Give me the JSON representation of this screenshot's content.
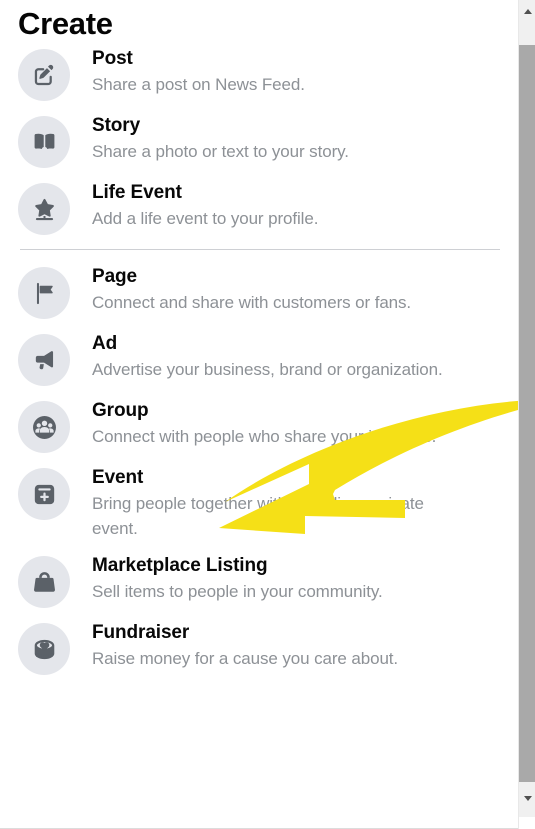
{
  "panel": {
    "title": "Create",
    "groups": [
      {
        "id": "personal",
        "items": [
          {
            "icon": "edit-square-icon",
            "title": "Post",
            "desc": "Share a post on News Feed."
          },
          {
            "icon": "open-book-icon",
            "title": "Story",
            "desc": "Share a photo or text to your story."
          },
          {
            "icon": "star-badge-icon",
            "title": "Life Event",
            "desc": "Add a life event to your profile."
          }
        ]
      },
      {
        "id": "business",
        "items": [
          {
            "icon": "flag-icon",
            "title": "Page",
            "desc": "Connect and share with customers or fans."
          },
          {
            "icon": "megaphone-icon",
            "title": "Ad",
            "desc": "Advertise your business, brand or organization."
          },
          {
            "icon": "people-group-icon",
            "title": "Group",
            "desc": "Connect with people who share your interests."
          },
          {
            "icon": "calendar-plus-icon",
            "title": "Event",
            "desc": "Bring people together with a public or private event."
          },
          {
            "icon": "shopping-bag-icon",
            "title": "Marketplace Listing",
            "desc": "Sell items to people in your community."
          },
          {
            "icon": "heart-coin-icon",
            "title": "Fundraiser",
            "desc": "Raise money for a cause you care about."
          }
        ]
      }
    ]
  },
  "annotation": {
    "type": "curved-arrow-left",
    "color": "#F5E017",
    "points_to": "Group"
  },
  "scrollbar": {
    "up_arrow": "scroll-up-arrow",
    "down_arrow": "scroll-down-arrow",
    "thumb_color": "#a9a9a9",
    "track_color": "#f0f0f0"
  },
  "colors": {
    "title_text": "#050505",
    "item_title_text": "#080808",
    "item_desc_text": "#8d9196",
    "icon_bg": "#e4e6eb",
    "icon_fill": "#5b6168",
    "divider": "#ced0d4",
    "annotation_yellow": "#F5E017"
  }
}
